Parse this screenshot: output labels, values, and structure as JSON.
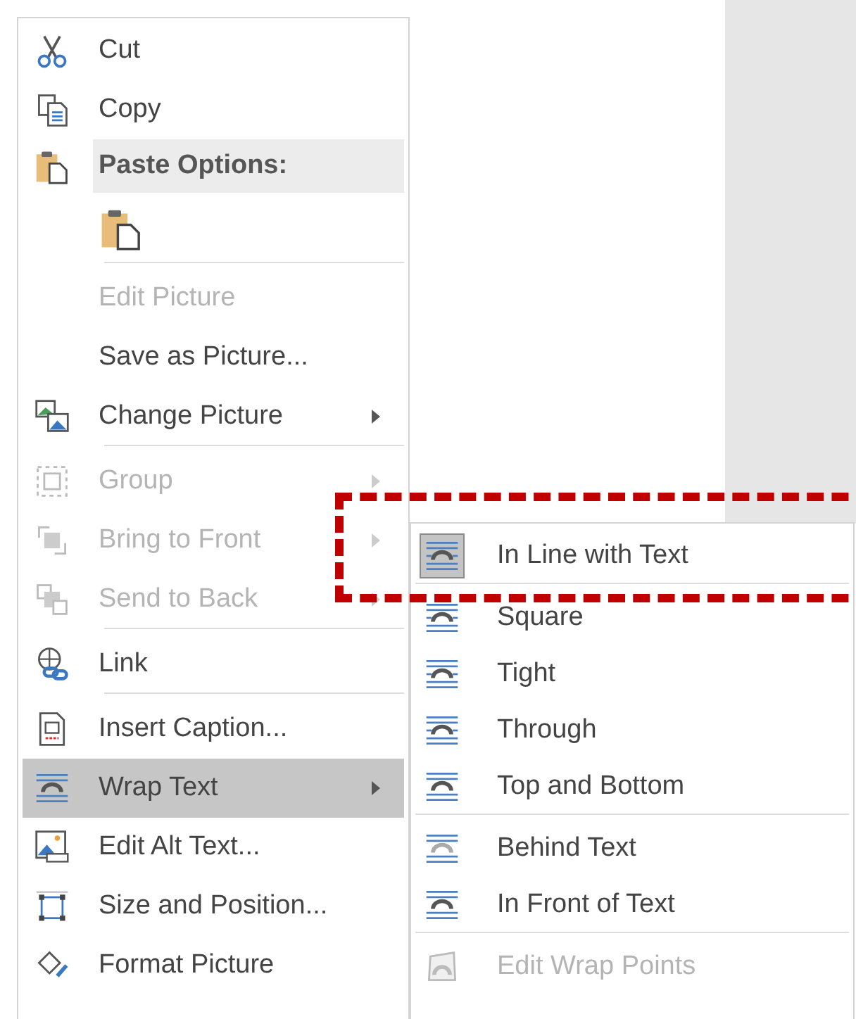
{
  "context_menu": {
    "items": [
      {
        "kind": "item",
        "label": "Cut",
        "disabled": false,
        "has_submenu": false,
        "selected": false,
        "separator_after": false
      },
      {
        "kind": "item",
        "label": "Copy",
        "disabled": false,
        "has_submenu": false,
        "selected": false,
        "separator_after": false
      },
      {
        "kind": "header",
        "label": "Paste Options:"
      },
      {
        "kind": "paste-row"
      },
      {
        "kind": "item",
        "label": "Edit Picture",
        "disabled": true,
        "has_submenu": false,
        "selected": false,
        "separator_after": false
      },
      {
        "kind": "item",
        "label": "Save as Picture...",
        "disabled": false,
        "has_submenu": false,
        "selected": false,
        "separator_after": false
      },
      {
        "kind": "item",
        "label": "Change Picture",
        "disabled": false,
        "has_submenu": true,
        "selected": false,
        "separator_after": true
      },
      {
        "kind": "item",
        "label": "Group",
        "disabled": true,
        "has_submenu": true,
        "selected": false,
        "separator_after": false
      },
      {
        "kind": "item",
        "label": "Bring to Front",
        "disabled": true,
        "has_submenu": true,
        "selected": false,
        "separator_after": false
      },
      {
        "kind": "item",
        "label": "Send to Back",
        "disabled": true,
        "has_submenu": true,
        "selected": false,
        "separator_after": true
      },
      {
        "kind": "item",
        "label": "Link",
        "disabled": false,
        "has_submenu": false,
        "selected": false,
        "separator_after": true
      },
      {
        "kind": "item",
        "label": "Insert Caption...",
        "disabled": false,
        "has_submenu": false,
        "selected": false,
        "separator_after": false
      },
      {
        "kind": "item",
        "label": "Wrap Text",
        "disabled": false,
        "has_submenu": true,
        "selected": true,
        "separator_after": false
      },
      {
        "kind": "item",
        "label": "Edit Alt Text...",
        "disabled": false,
        "has_submenu": false,
        "selected": false,
        "separator_after": false
      },
      {
        "kind": "item",
        "label": "Size and Position...",
        "disabled": false,
        "has_submenu": false,
        "selected": false,
        "separator_after": false
      },
      {
        "kind": "item",
        "label": "Format Picture",
        "disabled": false,
        "has_submenu": false,
        "selected": false,
        "separator_after": false
      }
    ]
  },
  "wrap_submenu": {
    "items": [
      {
        "label": "In Line with Text",
        "checked": true,
        "disabled": false,
        "separator_after": true
      },
      {
        "label": "Square",
        "checked": false,
        "disabled": false,
        "separator_after": false
      },
      {
        "label": "Tight",
        "checked": false,
        "disabled": false,
        "separator_after": false
      },
      {
        "label": "Through",
        "checked": false,
        "disabled": false,
        "separator_after": false
      },
      {
        "label": "Top and Bottom",
        "checked": false,
        "disabled": false,
        "separator_after": true
      },
      {
        "label": "Behind Text",
        "checked": false,
        "disabled": false,
        "separator_after": false
      },
      {
        "label": "In Front of Text",
        "checked": false,
        "disabled": false,
        "separator_after": true
      },
      {
        "label": "Edit Wrap Points",
        "checked": false,
        "disabled": true,
        "separator_after": false
      }
    ]
  },
  "highlight": {
    "shown": true
  }
}
